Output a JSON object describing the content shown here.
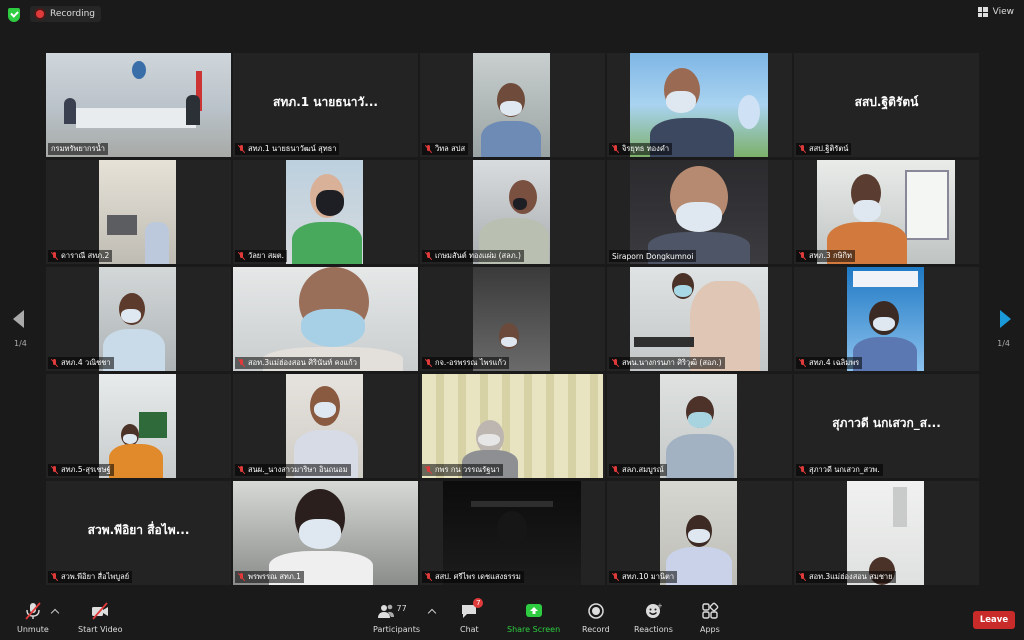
{
  "topbar": {
    "recording_label": "Recording",
    "view_label": "View"
  },
  "pagination": {
    "left": "1/4",
    "right": "1/4"
  },
  "tiles": [
    {
      "name": "กรมทรัพยากรน้ำ",
      "big": "",
      "active": true
    },
    {
      "name": "สทภ.1 นายธนาวัฒน์ สุทธา",
      "big": "สทภ.1 นายธนาวั..."
    },
    {
      "name": "วิทล สปส",
      "big": ""
    },
    {
      "name": "จิรยุทธ ทองคำ",
      "big": ""
    },
    {
      "name": "สสป.ฐิติรัตน์",
      "big": "สสป.ฐิติรัตน์"
    },
    {
      "name": "ดาราณี สทภ.2",
      "big": ""
    },
    {
      "name": "วัลยา สผต.",
      "big": ""
    },
    {
      "name": "เกษมสันต์ ทองแผ่ม (สลภ.)",
      "big": ""
    },
    {
      "name": "Siraporn Dongkumnoi",
      "big": ""
    },
    {
      "name": "สทภ.3  กษิกิท",
      "big": ""
    },
    {
      "name": "สทภ.4 วณิชชา",
      "big": ""
    },
    {
      "name": "สอท.3แม่ฮ่องสอน ศิรินันท์ คงแก้ว",
      "big": ""
    },
    {
      "name": "กจ.-อรพรรณ  ไพรแก้ว",
      "big": ""
    },
    {
      "name": "สพน.นางกรนภา ศิริวุฒิ (สอภ.)",
      "big": ""
    },
    {
      "name": "สทภ.4 เฉลิมพร",
      "big": ""
    },
    {
      "name": "สทภ.5-สุรเชษฐ์",
      "big": ""
    },
    {
      "name": "สนผ._นางสาวมาริษา อินถนอม",
      "big": ""
    },
    {
      "name": "กพร กน วรรณรัฐนา",
      "big": ""
    },
    {
      "name": "สลภ.สมบูรณ์",
      "big": ""
    },
    {
      "name": "สุภาวดี นกเสวก_สวพ.",
      "big": "สุภาวดี นกเสวก_ส..."
    },
    {
      "name": "สวพ.พีอิยา สื่อไพบูลย์",
      "big": "สวพ.พีอิยา สื่อไพ..."
    },
    {
      "name": "พรพรรณ สทภ.1",
      "big": ""
    },
    {
      "name": "สสป. ศรีไพร เดชแสงธรรม",
      "big": ""
    },
    {
      "name": "สทภ.10  มานิตา",
      "big": ""
    },
    {
      "name": "สอท.3แม่ฮ่องสอน สมชาย",
      "big": ""
    }
  ],
  "toolbar": {
    "unmute": "Unmute",
    "start_video": "Start Video",
    "participants": "Participants",
    "participants_count": "77",
    "chat": "Chat",
    "chat_badge": "7",
    "share_screen": "Share Screen",
    "record": "Record",
    "reactions": "Reactions",
    "apps": "Apps",
    "leave": "Leave"
  },
  "colors": {
    "active_outline": "#e6e24a",
    "share_green": "#2ecc40",
    "leave_red": "#c92a2a",
    "recording_red": "#e03a3a"
  }
}
